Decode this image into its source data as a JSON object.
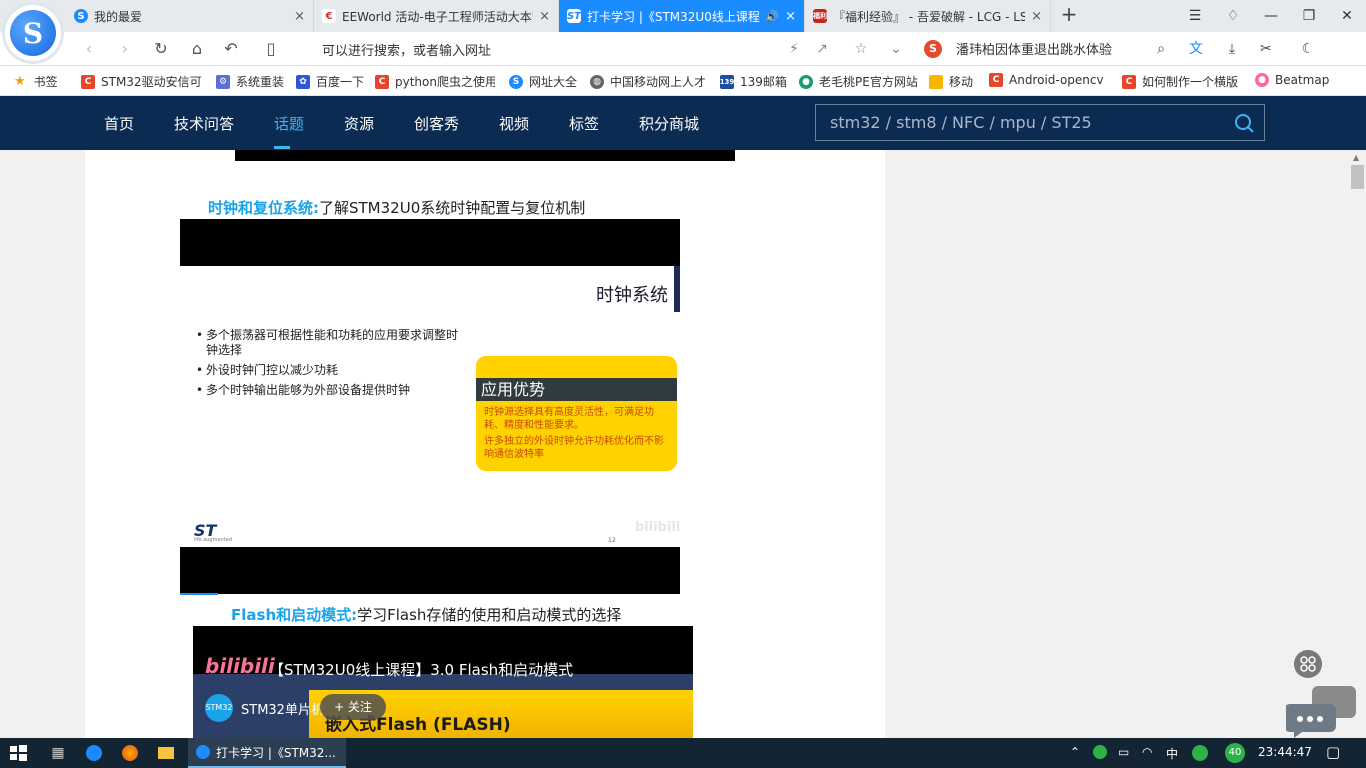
{
  "browser": {
    "tabs": [
      {
        "title": "我的最爱",
        "icon": "sogou-browser-icon",
        "active": false
      },
      {
        "title": "EEWorld 活动-电子工程师活动大本营",
        "icon": "eeworld-icon",
        "active": false
      },
      {
        "title": "打卡学习 |《STM32U0线上课程",
        "icon": "st-icon",
        "active": true
      },
      {
        "title": "『福利经验』 - 吾爱破解 - LCG - LSG",
        "icon": "52pojie-icon",
        "active": false
      }
    ],
    "tab_close": "×",
    "new_tab": "+",
    "address_placeholder": "可以进行搜索，或者输入网址",
    "hot_search": "潘玮柏因体重退出跳水体验",
    "bookmarks": [
      {
        "label": "书签",
        "icon": "star-icon"
      },
      {
        "label": "STM32驱动安信可",
        "icon": "csdn-icon"
      },
      {
        "label": "系统重装",
        "icon": "system-icon"
      },
      {
        "label": "百度一下",
        "icon": "baidu-icon"
      },
      {
        "label": "python爬虫之使用",
        "icon": "csdn-icon"
      },
      {
        "label": "网址大全",
        "icon": "sogou-icon"
      },
      {
        "label": "中国移动网上人才",
        "icon": "globe-icon"
      },
      {
        "label": "139邮箱",
        "icon": "mail-icon"
      },
      {
        "label": "老毛桃PE官方网站",
        "icon": "pe-icon"
      },
      {
        "label": "移动",
        "icon": "folder-icon"
      },
      {
        "label": "Android-opencv",
        "icon": "csdn-icon"
      },
      {
        "label": "如何制作一个横版",
        "icon": "csdn-icon"
      },
      {
        "label": "Beatmap",
        "icon": "osu-icon"
      }
    ]
  },
  "site": {
    "nav": [
      "首页",
      "技术问答",
      "话题",
      "资源",
      "创客秀",
      "视频",
      "标签",
      "积分商城"
    ],
    "active_nav": "话题",
    "search_placeholder": "stm32 / stm8 / NFC / mpu / ST25"
  },
  "article": {
    "section1": {
      "highlight": "时钟和复位系统:",
      "text": "了解STM32U0系统时钟配置与复位机制"
    },
    "slide": {
      "title": "时钟系统",
      "bullets": [
        "多个振荡器可根据性能和功耗的应用要求调整时钟选择",
        "外设时钟门控以减少功耗",
        "多个时钟输出能够为外部设备提供时钟"
      ],
      "card_title": "应用优势",
      "card_points": [
        "时钟源选择具有高度灵活性，可满足功耗、精度和性能要求。",
        "许多独立的外设时钟允许功耗优化而不影响通信波特率"
      ],
      "logo": "ST",
      "logo_sub": "life.augmented",
      "page_number": "12",
      "watermark": "bilibili"
    },
    "section2": {
      "highlight": "Flash和启动模式:",
      "text": "学习Flash存储的使用和启动模式的选择"
    },
    "video": {
      "brand": "bilibili",
      "title": "【STM32U0线上课程】3.0 Flash和启动模式",
      "channel": "STM32单片机",
      "avatar_text": "STM32",
      "follow": "+ 关注",
      "frame_text": "嵌入式Flash (FLASH)"
    }
  },
  "taskbar": {
    "task_label": "打卡学习 |《STM32...",
    "ime": "中",
    "badge": "40",
    "time": "23:44:47"
  }
}
